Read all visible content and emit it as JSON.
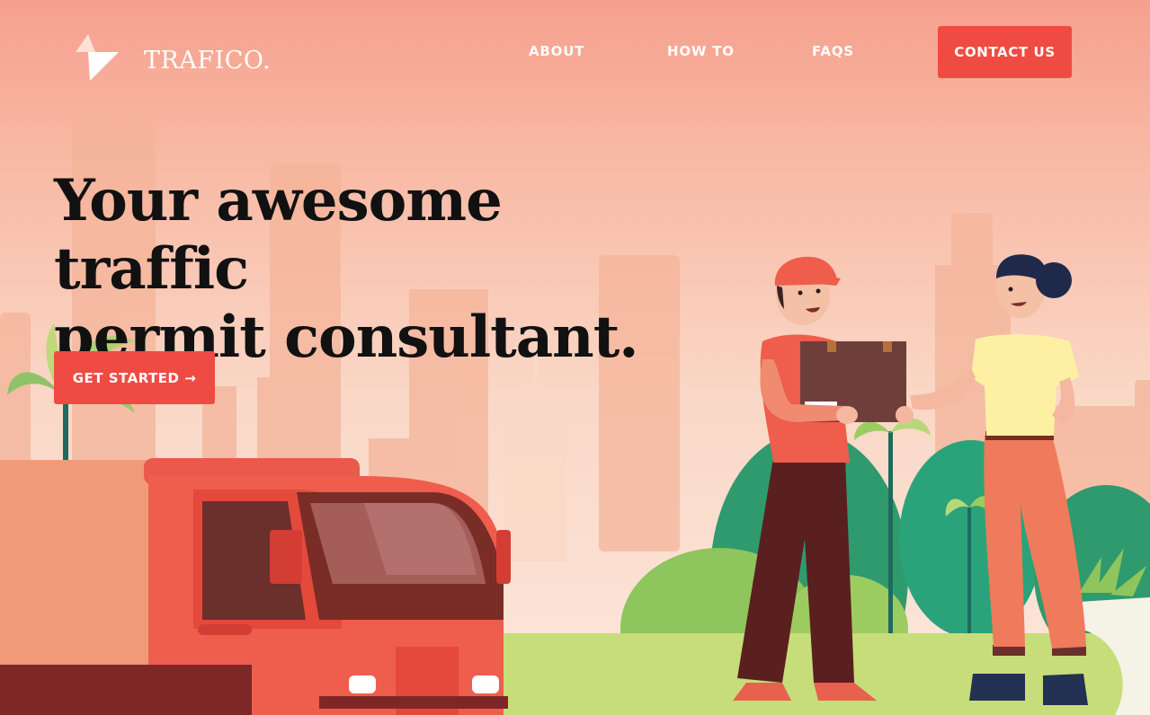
{
  "brand": {
    "name": "TRAFICO.",
    "logo_icon": "bolt-arrow-logo-icon"
  },
  "nav": {
    "items": [
      {
        "label": "ABOUT"
      },
      {
        "label": "HOW TO"
      },
      {
        "label": "FAQS"
      }
    ],
    "contact_label": "CONTACT US"
  },
  "hero": {
    "title_line1": "Your awesome traffic",
    "title_line2": "permit consultant.",
    "cta_label": "GET STARTED →"
  },
  "colors": {
    "accent": "#ef4b42",
    "sky_top": "#f6a08e",
    "sky_bottom": "#fce8dc",
    "title_text": "#111111"
  }
}
